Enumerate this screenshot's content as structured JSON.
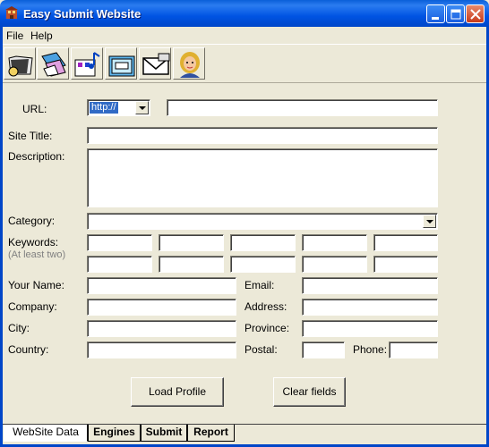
{
  "window": {
    "title": "Easy Submit Website"
  },
  "menu": {
    "items": [
      "File",
      "Help"
    ]
  },
  "toolbar": {
    "buttons": [
      "open-icon",
      "edit-icon",
      "music-icon",
      "folder-icon",
      "mail-icon",
      "assistant-icon"
    ]
  },
  "form": {
    "url_label": "URL:",
    "url_protocol": "http://",
    "url_value": "",
    "site_title_label": "Site Title:",
    "site_title_value": "",
    "description_label": "Description:",
    "description_value": "",
    "category_label": "Category:",
    "category_value": "",
    "keywords_label": "Keywords:",
    "keywords_hint": "(At least two)",
    "your_name_label": "Your Name:",
    "email_label": "Email:",
    "company_label": "Company:",
    "address_label": "Address:",
    "city_label": "City:",
    "province_label": "Province:",
    "country_label": "Country:",
    "postal_label": "Postal:",
    "phone_label": "Phone:"
  },
  "actions": {
    "load_profile": "Load Profile",
    "clear_fields": "Clear fields"
  },
  "tabs": [
    "WebSite Data",
    "Engines",
    "Submit",
    "Report"
  ]
}
